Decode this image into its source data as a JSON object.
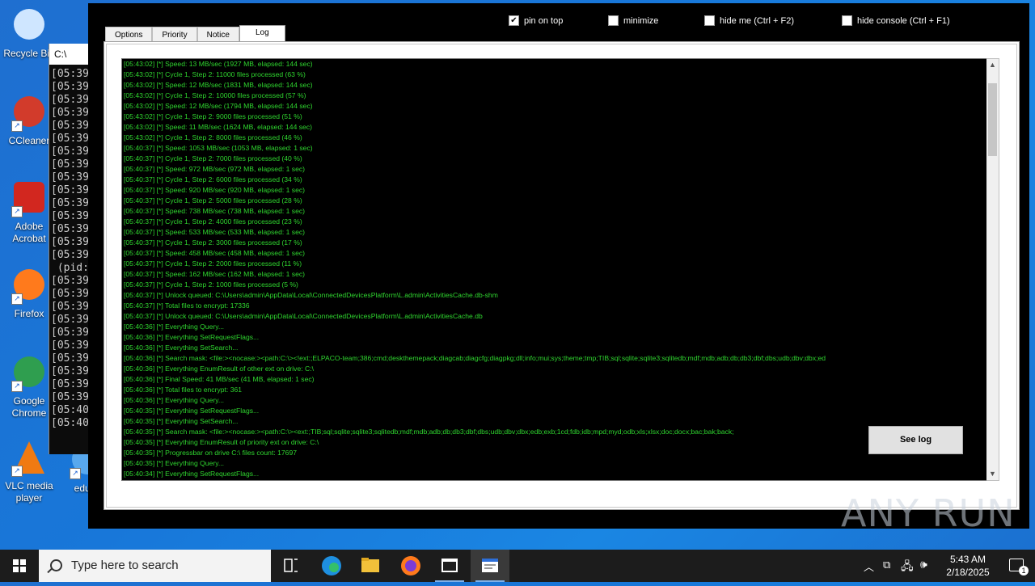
{
  "desktop": {
    "icons": [
      {
        "label": "Recycle Bin",
        "name": "recycle-bin"
      },
      {
        "label": "CCleaner",
        "name": "ccleaner"
      },
      {
        "label": "Adobe Acrobat",
        "name": "adobe-acrobat"
      },
      {
        "label": "Firefox",
        "name": "firefox"
      },
      {
        "label": "Google Chrome",
        "name": "google-chrome"
      },
      {
        "label": "VLC media player",
        "name": "vlc"
      },
      {
        "label": "educa",
        "name": "educa"
      }
    ]
  },
  "console": {
    "title": "C:\\",
    "lines": [
      "[05:39",
      "[05:39",
      "[05:39",
      "[05:39",
      "[05:39",
      "[05:39",
      "[05:39",
      "[05:39",
      "[05:39",
      "[05:39",
      "[05:39",
      "[05:39",
      "[05:39",
      "[05:39",
      "[05:39",
      " (pid:",
      "[05:39",
      "[05:39",
      "[05:39",
      "[05:39",
      "[05:39",
      "[05:39",
      "[05:39",
      "[05:39",
      "[05:39",
      "[05:39",
      "[05:40",
      "[05:40"
    ]
  },
  "toolbar": {
    "pin_on_top": {
      "label": "pin on top",
      "checked": true
    },
    "minimize": {
      "label": "minimize",
      "checked": false
    },
    "hide_me": {
      "label": "hide me (Ctrl + F2)",
      "checked": false
    },
    "hide_console": {
      "label": "hide console (Ctrl + F1)",
      "checked": false
    }
  },
  "tabs": [
    "Options",
    "Priority",
    "Notice",
    "Log"
  ],
  "active_tab": "Log",
  "log_lines": [
    "[05:43:02] [*] Speed: 13 MB/sec (1927 MB, elapsed: 144 sec)",
    "[05:43:02] [*] Cycle 1, Step 2: 11000 files processed (63 %)",
    "[05:43:02] [*] Speed: 12 MB/sec (1831 MB, elapsed: 144 sec)",
    "[05:43:02] [*] Cycle 1, Step 2: 10000 files processed (57 %)",
    "[05:43:02] [*] Speed: 12 MB/sec (1794 MB, elapsed: 144 sec)",
    "[05:43:02] [*] Cycle 1, Step 2: 9000 files processed (51 %)",
    "[05:43:02] [*] Speed: 11 MB/sec (1624 MB, elapsed: 144 sec)",
    "[05:43:02] [*] Cycle 1, Step 2: 8000 files processed (46 %)",
    "[05:40:37] [*] Speed: 1053 MB/sec (1053 MB, elapsed: 1 sec)",
    "[05:40:37] [*] Cycle 1, Step 2: 7000 files processed (40 %)",
    "[05:40:37] [*] Speed: 972 MB/sec (972 MB, elapsed: 1 sec)",
    "[05:40:37] [*] Cycle 1, Step 2: 6000 files processed (34 %)",
    "[05:40:37] [*] Speed: 920 MB/sec (920 MB, elapsed: 1 sec)",
    "[05:40:37] [*] Cycle 1, Step 2: 5000 files processed (28 %)",
    "[05:40:37] [*] Speed: 738 MB/sec (738 MB, elapsed: 1 sec)",
    "[05:40:37] [*] Cycle 1, Step 2: 4000 files processed (23 %)",
    "[05:40:37] [*] Speed: 533 MB/sec (533 MB, elapsed: 1 sec)",
    "[05:40:37] [*] Cycle 1, Step 2: 3000 files processed (17 %)",
    "[05:40:37] [*] Speed: 458 MB/sec (458 MB, elapsed: 1 sec)",
    "[05:40:37] [*] Cycle 1, Step 2: 2000 files processed (11 %)",
    "[05:40:37] [*] Speed: 162 MB/sec (162 MB, elapsed: 1 sec)",
    "[05:40:37] [*] Cycle 1, Step 2: 1000 files processed (5 %)",
    "[05:40:37] [*] Unlock queued: C:\\Users\\admin\\AppData\\Local\\ConnectedDevicesPlatform\\L.admin\\ActivitiesCache.db-shm",
    "[05:40:37] [*] Total files to encrypt: 17336",
    "[05:40:37] [*] Unlock queued: C:\\Users\\admin\\AppData\\Local\\ConnectedDevicesPlatform\\L.admin\\ActivitiesCache.db",
    "[05:40:36] [*] Everything Query...",
    "[05:40:36] [*] Everything SetRequestFlags...",
    "[05:40:36] [*] Everything SetSearch...",
    "[05:40:36] [*] Search mask: <file:><nocase:><path:C:\\><!ext:;ELPACO-team;386;cmd;deskthemepack;diagcab;diagcfg;diagpkg;dll;info;mui;sys;theme;tmp;TIB;sql;sqlite;sqlite3;sqlitedb;mdf;mdb;adb;db;db3;dbf;dbs;udb;dbv;dbx;ed",
    "[05:40:36] [*] Everything EnumResult of other ext on drive: C:\\",
    "[05:40:36] [*] Final Speed: 41 MB/sec (41 MB, elapsed: 1 sec)",
    "[05:40:36] [*] Total files to encrypt: 361",
    "[05:40:36] [*] Everything Query...",
    "[05:40:35] [*] Everything SetRequestFlags...",
    "[05:40:35] [*] Everything SetSearch...",
    "[05:40:35] [*] Search mask: <file:><nocase:><path:C:\\><ext:;TIB;sql;sqlite;sqlite3;sqlitedb;mdf;mdb;adb;db;db3;dbf;dbs;udb;dbv;dbx;edb;exb;1cd;fdb;idb;mpd;myd;odb;xls;xlsx;doc;docx;bac;bak;back;",
    "[05:40:35] [*] Everything EnumResult of priority ext on drive: C:\\",
    "[05:40:35] [*] Progressbar on drive C:\\ files count: 17697",
    "[05:40:35] [*] Everything Query...",
    "[05:40:34] [*] Everything SetRequestFlags..."
  ],
  "see_log_button": "See log",
  "watermark": "ANY RUN",
  "taskbar": {
    "search_placeholder": "Type here to search",
    "time": "5:43 AM",
    "date": "2/18/2025",
    "notification_count": "1"
  }
}
